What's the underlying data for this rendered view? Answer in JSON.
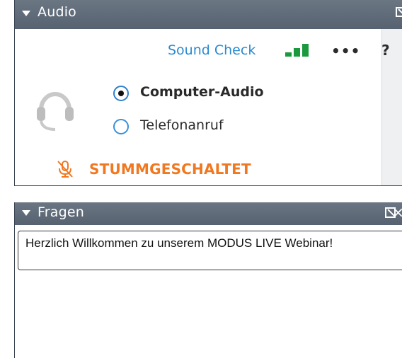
{
  "audio_panel": {
    "title": "Audio",
    "sound_check_label": "Sound Check",
    "more_label": "•••",
    "help_label": "?",
    "options": [
      {
        "label": "Computer-Audio",
        "selected": true
      },
      {
        "label": "Telefonanruf",
        "selected": false
      }
    ],
    "mute_status": "STUMMGESCHALTET",
    "colors": {
      "accent": "#2a8ad0",
      "signal": "#1a9a3c",
      "muted": "#f07820"
    }
  },
  "questions_panel": {
    "title": "Fragen",
    "close_label": "×",
    "message": "Herzlich Willkommen zu unserem MODUS LIVE Webinar!"
  }
}
